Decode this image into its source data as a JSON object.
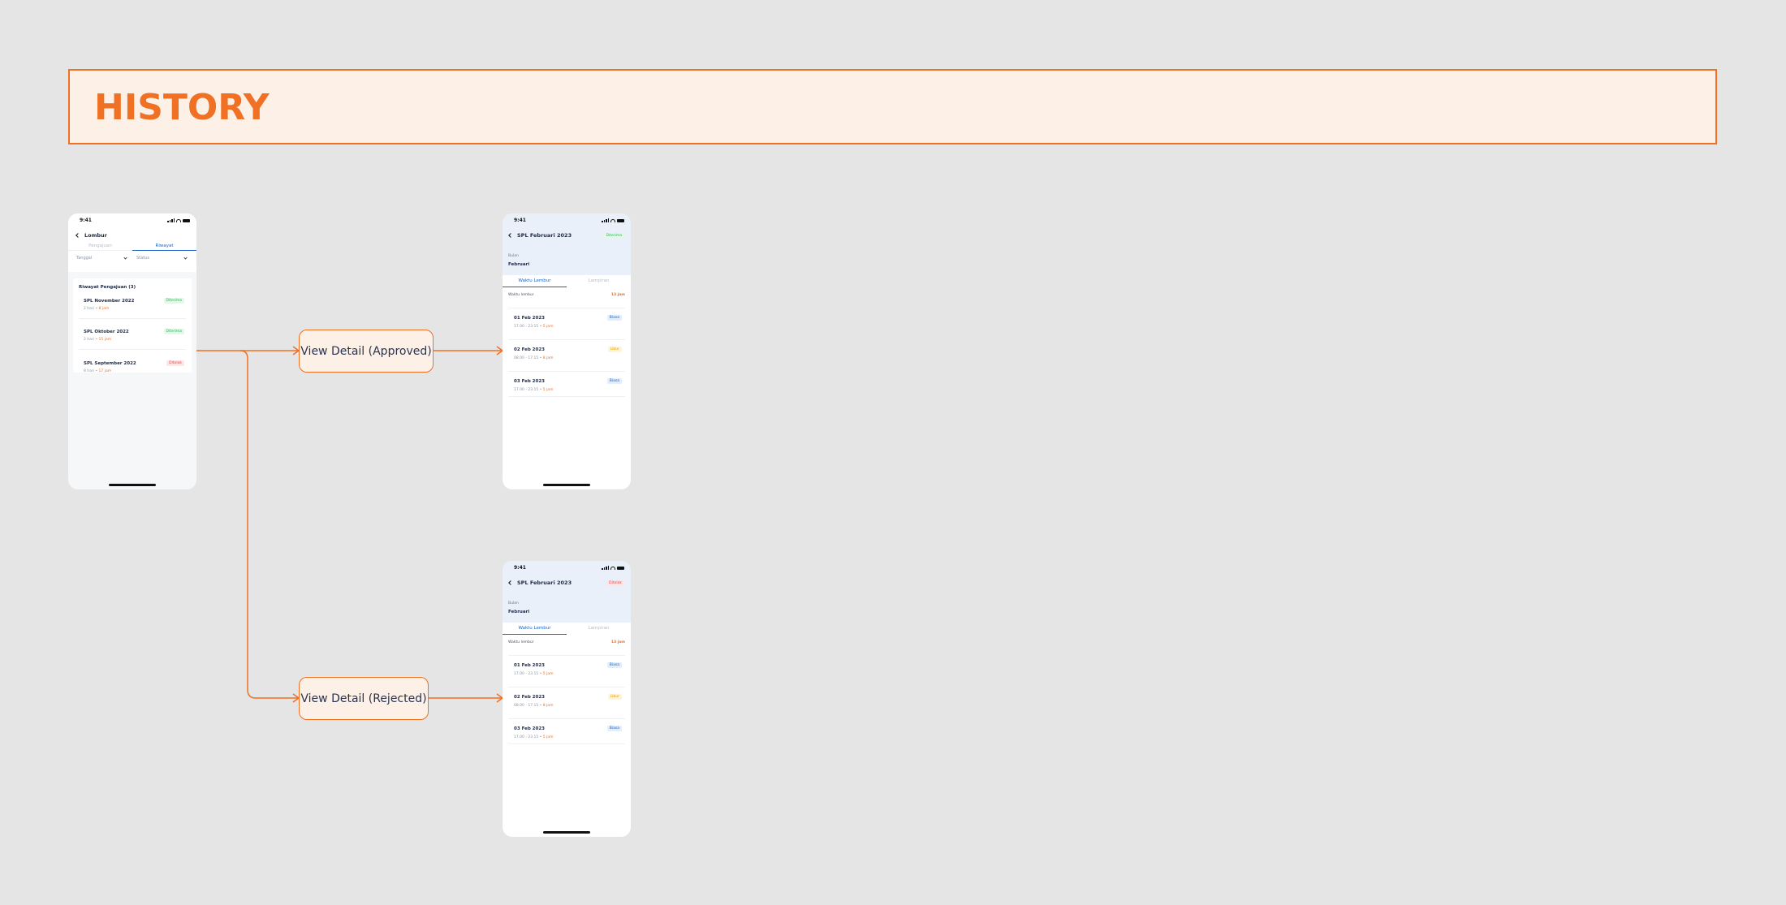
{
  "banner": {
    "title": "HISTORY"
  },
  "colors": {
    "accent": "#f07024",
    "primary": "#1a63c9",
    "approved": "#2db45b",
    "rejected": "#e5484d"
  },
  "list_screen": {
    "time": "9:41",
    "title": "Lombur",
    "tabs": [
      "Pengajuan",
      "Riwayat"
    ],
    "filters": [
      "Tanggal",
      "Status"
    ],
    "section_title": "Riwayat Pengajuan (3)",
    "items": [
      {
        "name": "SPL November 2022",
        "days": "2 hari",
        "hours": "8 jam",
        "status": "Diterima"
      },
      {
        "name": "SPL Oktober 2022",
        "days": "2 hari",
        "hours": "15 jam",
        "status": "Diterima"
      },
      {
        "name": "SPL September 2022",
        "days": "8 hari",
        "hours": "17 jam",
        "status": "Ditolak"
      }
    ]
  },
  "flow": {
    "approved_label": "View Detail (Approved)",
    "rejected_label": "View Detail (Rejected)"
  },
  "detail_approved": {
    "time": "9:41",
    "title": "SPL Februari 2023",
    "status": "Diterima",
    "month_label": "Bulan",
    "month_value": "Februari",
    "tabs": [
      "Waktu Lembur",
      "Lampiran"
    ],
    "total_label": "Waktu lembur",
    "total_value": "13 jam",
    "entries": [
      {
        "date": "01 Feb 2023",
        "range": "17.00 - 23.15",
        "hours": "5 jam",
        "type": "Biasa"
      },
      {
        "date": "02 Feb 2023",
        "range": "08.00 - 17.15",
        "hours": "8 jam",
        "type": "Libur"
      },
      {
        "date": "03 Feb 2023",
        "range": "17.00 - 23.15",
        "hours": "5 jam",
        "type": "Biasa"
      }
    ]
  },
  "detail_rejected": {
    "time": "9:41",
    "title": "SPL Februari 2023",
    "status": "Ditolak",
    "month_label": "Bulan",
    "month_value": "Februari",
    "tabs": [
      "Waktu Lembur",
      "Lampiran"
    ],
    "total_label": "Waktu lembur",
    "total_value": "13 jam",
    "entries": [
      {
        "date": "01 Feb 2023",
        "range": "17.00 - 23.15",
        "hours": "5 jam",
        "type": "Biasa"
      },
      {
        "date": "02 Feb 2023",
        "range": "08.00 - 17.15",
        "hours": "8 jam",
        "type": "Libur"
      },
      {
        "date": "03 Feb 2023",
        "range": "17.00 - 23.15",
        "hours": "5 jam",
        "type": "Biasa"
      }
    ]
  }
}
